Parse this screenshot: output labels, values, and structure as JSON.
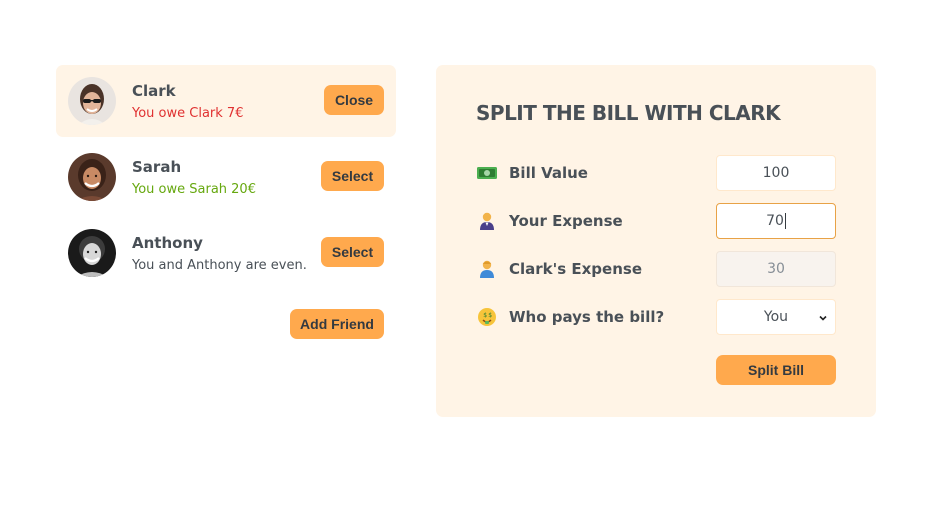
{
  "friends": [
    {
      "name": "Clark",
      "status": "You owe Clark 7€",
      "button": "Close",
      "selected": true
    },
    {
      "name": "Sarah",
      "status": "You owe Sarah 20€",
      "button": "Select",
      "selected": false
    },
    {
      "name": "Anthony",
      "status": "You and Anthony are even.",
      "button": "Select",
      "selected": false
    }
  ],
  "sidebar": {
    "add_friend_label": "Add Friend"
  },
  "split_form": {
    "title": "SPLIT THE BILL WITH CLARK",
    "bill_value": {
      "icon": "money-icon",
      "label": "Bill Value",
      "value": "100"
    },
    "your_expense": {
      "icon": "person-icon",
      "label": "Your Expense",
      "value": "70"
    },
    "friend_expense": {
      "icon": "person-icon",
      "label": "Clark's Expense",
      "value": "30"
    },
    "who_pays": {
      "icon": "money-face-icon",
      "label": "Who pays the bill?",
      "selected": "You"
    },
    "submit_label": "Split Bill"
  },
  "colors": {
    "accent": "#ffa94d",
    "panel_bg": "#fff4e6",
    "owe_red": "#e03131",
    "owed_green": "#66a80f",
    "text": "#495057"
  }
}
